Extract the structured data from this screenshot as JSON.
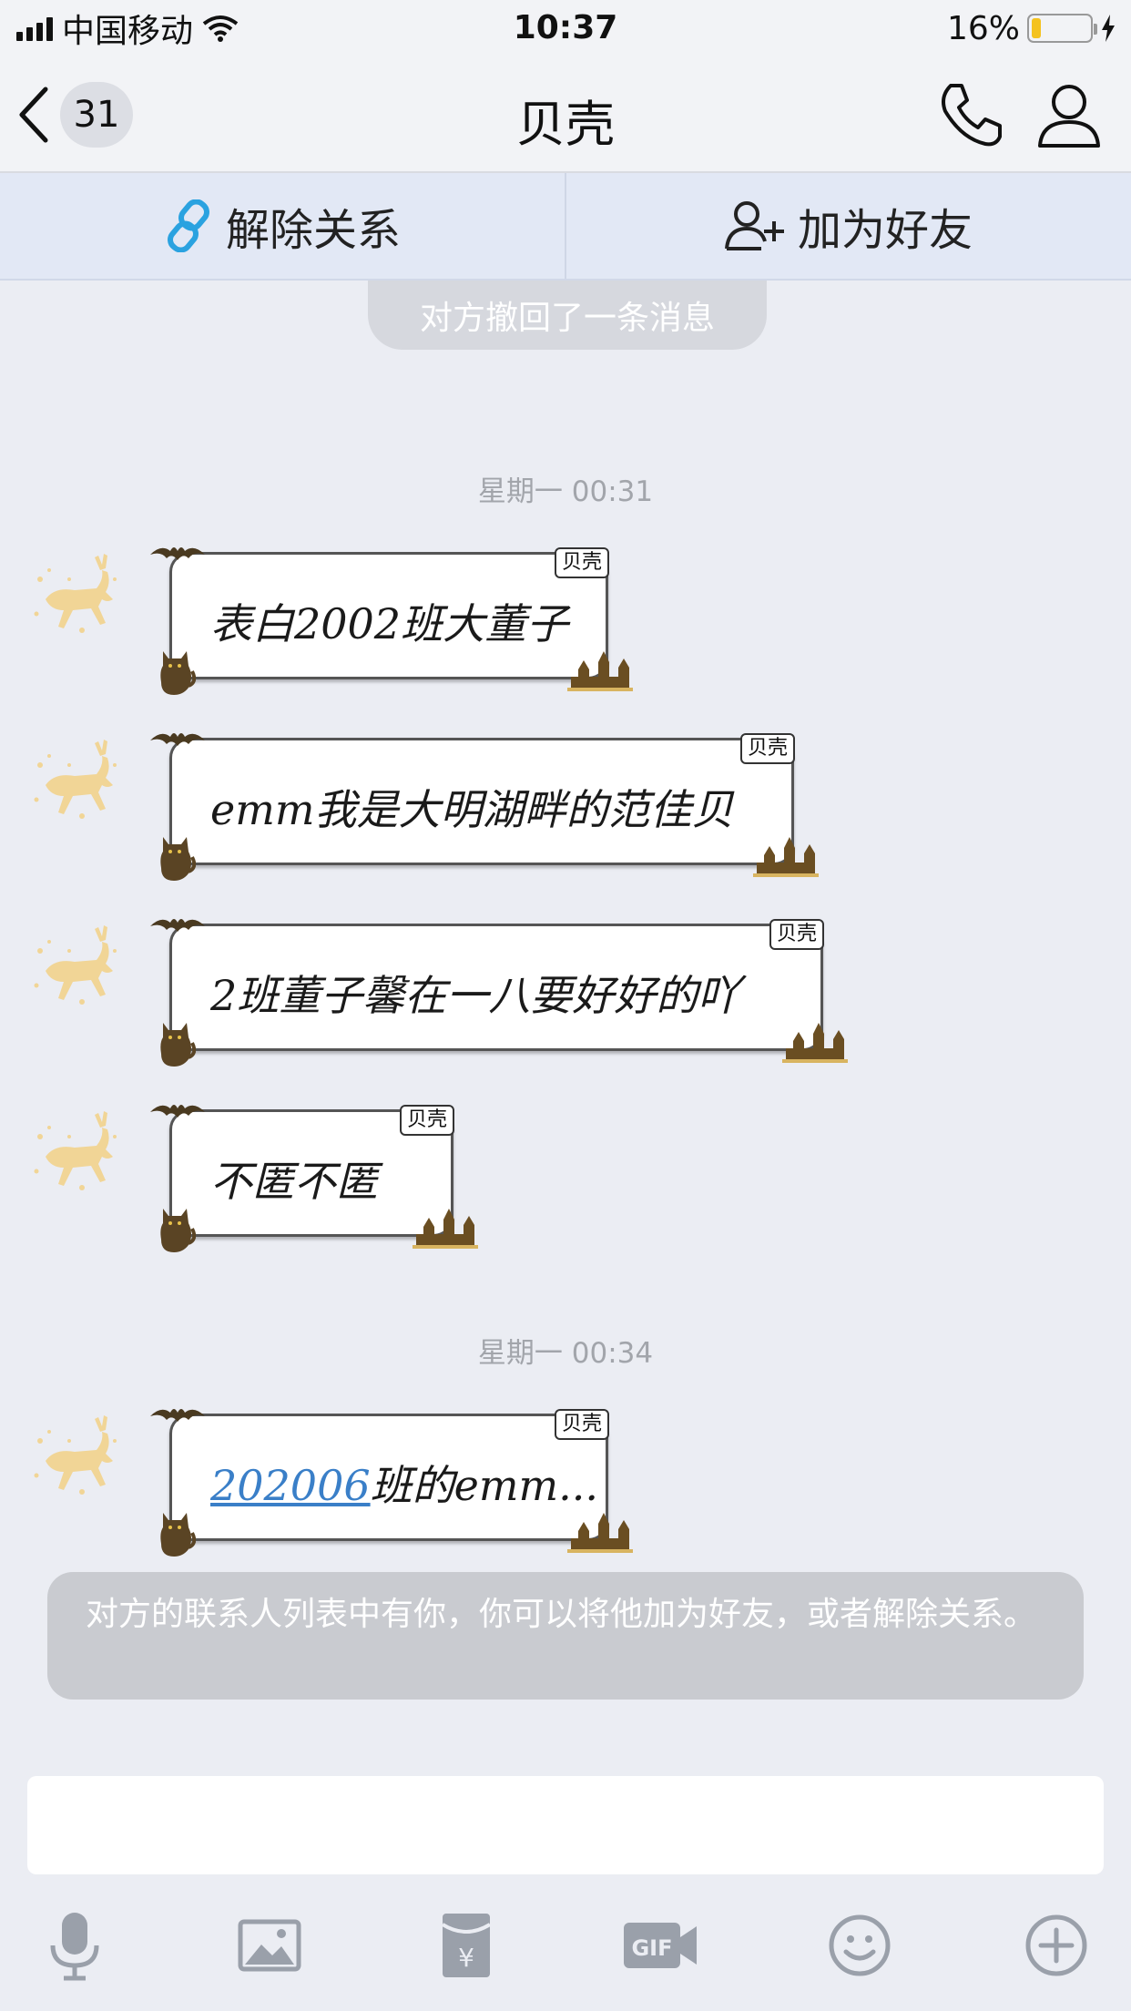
{
  "status_bar": {
    "carrier": "中国移动",
    "time": "10:37",
    "battery_percent": "16%",
    "battery_level": 0.16
  },
  "nav": {
    "unread_count": "31",
    "title": "贝壳"
  },
  "actions": {
    "unbind": "解除关系",
    "add_friend": "加为好友"
  },
  "recall_tip": "对方撤回了一条消息",
  "timestamps": [
    "星期一 00:31",
    "星期一 00:34"
  ],
  "bubble_tag": "贝壳",
  "messages": [
    {
      "text": "表白2002班大董子"
    },
    {
      "text": "emm我是大明湖畔的范佳贝"
    },
    {
      "text": "2班董子馨在一八要好好的吖"
    },
    {
      "text": "不匿不匿"
    },
    {
      "link": "202006",
      "text": "班的emm..."
    }
  ],
  "notice": "对方的联系人列表中有你，你可以将他加为好友，或者解除关系。",
  "input": {
    "value": ""
  },
  "toolbar": [
    "voice-icon",
    "image-icon",
    "red-packet-icon",
    "gif-icon",
    "emoji-icon",
    "plus-icon"
  ],
  "colors": {
    "link": "#3a7fc8",
    "action_bar": "#e2e8f5",
    "unlink_icon": "#2aa2e0",
    "battery": "#f4c21e"
  }
}
